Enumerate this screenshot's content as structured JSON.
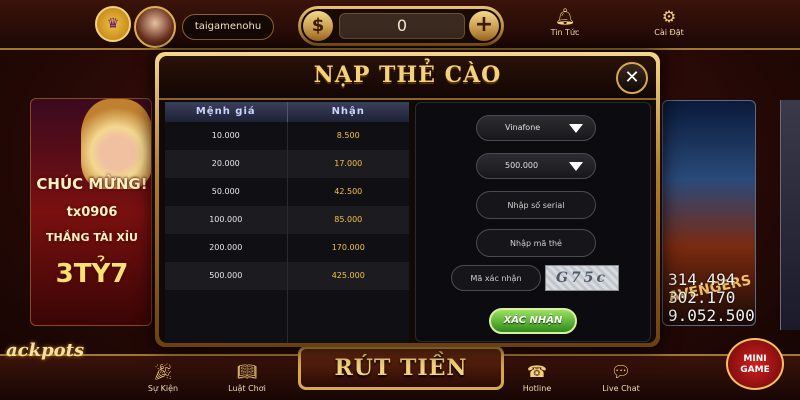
{
  "header": {
    "username": "taigamenohu",
    "balance": "0",
    "dollar_symbol": "$",
    "plus_symbol": "+",
    "news_label": "Tin Tức",
    "settings_label": "Cài Đặt"
  },
  "left_banner": {
    "line1": "CHÚC MỪNG!",
    "line2": "tx0906",
    "line3": "THẮNG TÀI XỈU",
    "line4": "3TỶ7"
  },
  "right_banner": {
    "title": "AVENGERS",
    "jackpot_values": [
      "314.494",
      "302.170",
      "9.052.500"
    ]
  },
  "modal": {
    "title": "NẠP THẺ CÀO",
    "close_symbol": "✕",
    "table": {
      "headers": [
        "Mệnh giá",
        "Nhận"
      ],
      "rows": [
        [
          "10.000",
          "8.500"
        ],
        [
          "20.000",
          "17.000"
        ],
        [
          "50.000",
          "42.500"
        ],
        [
          "100.000",
          "85.000"
        ],
        [
          "200.000",
          "170.000"
        ],
        [
          "500.000",
          "425.000"
        ]
      ]
    },
    "form": {
      "carrier_selected": "Vinafone",
      "amount_selected": "500.000",
      "serial_placeholder": "Nhập số serial",
      "code_placeholder": "Nhập mã thẻ",
      "captcha_placeholder": "Mã xác nhận",
      "captcha_text": "G75c",
      "submit_label": "XÁC NHẬN"
    }
  },
  "bottom": {
    "jackpots_logo": "ackpots",
    "events_label": "Sự Kiện",
    "rules_label": "Luật Chơi",
    "withdraw_label": "RÚT TIỀN",
    "hotline_label": "Hotline",
    "livechat_label": "Live Chat",
    "mini_game_label": "MINI GAME"
  },
  "icons": {
    "news": "bell-icon",
    "settings": "gear-icon",
    "events": "party-icon",
    "rules": "book-icon",
    "hotline": "phone-icon",
    "livechat": "chat-icon"
  },
  "colors": {
    "gold": "#f4d27a",
    "payout": "#f4c040",
    "submit_green": "#2e8a18"
  }
}
